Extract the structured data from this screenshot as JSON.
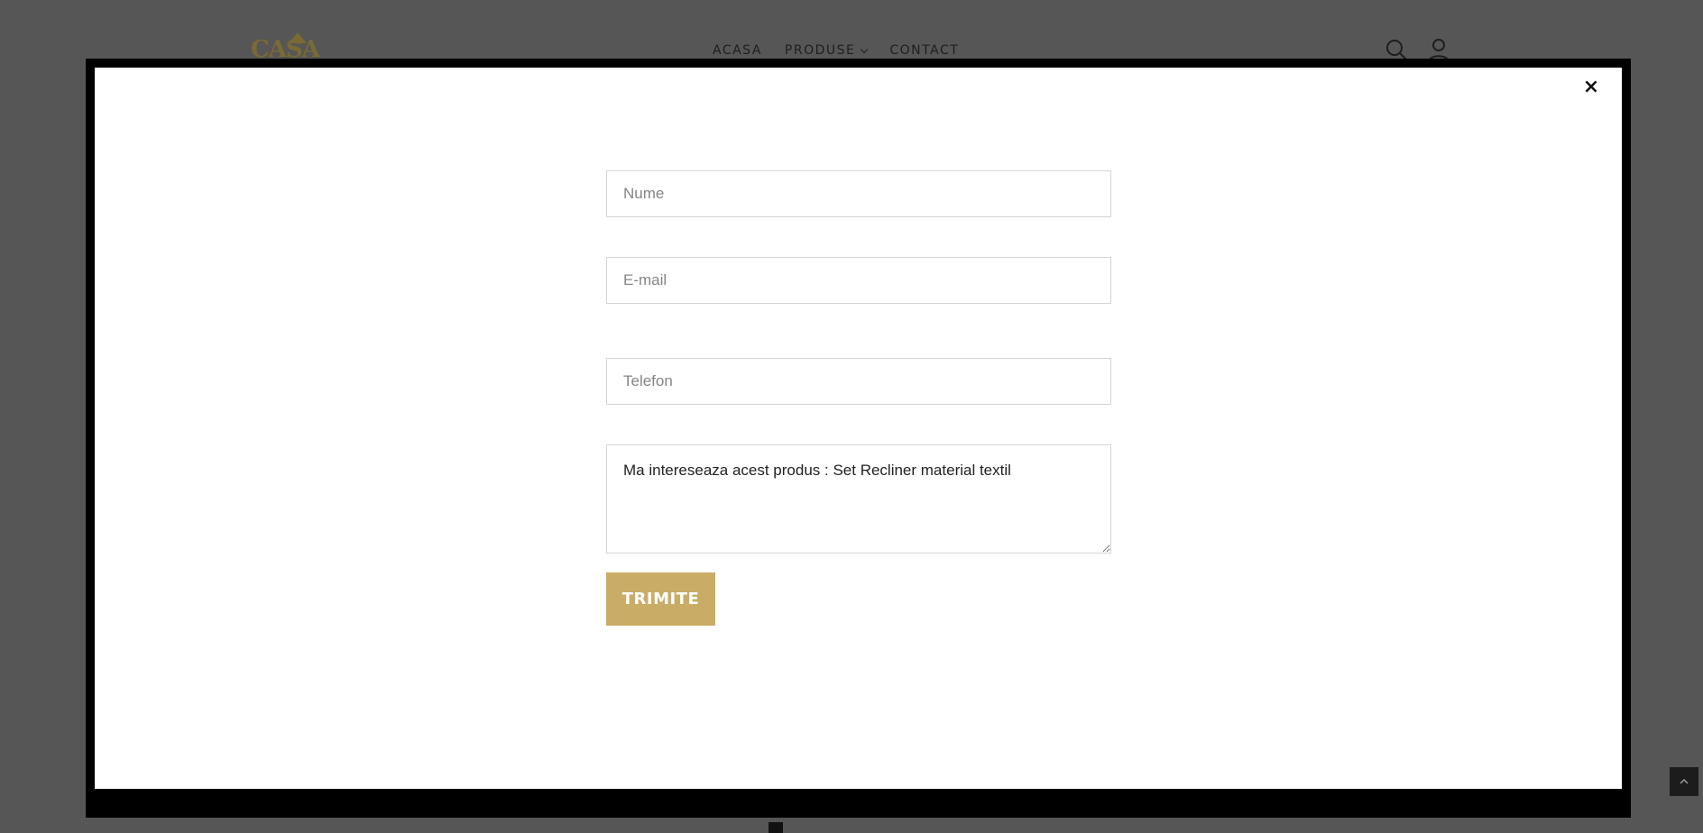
{
  "header": {
    "logo_text": "CASA",
    "nav": [
      {
        "label": "ACASA"
      },
      {
        "label": "PRODUSE"
      },
      {
        "label": "CONTACT"
      }
    ]
  },
  "modal": {
    "close_label": "×",
    "form": {
      "name_placeholder": "Nume",
      "email_placeholder": "E-mail",
      "phone_placeholder": "Telefon",
      "message_value": "Ma intereseaza acest produs : Set Recliner material textil",
      "submit_label": "TRIMITE"
    }
  },
  "colors": {
    "accent": "#c9ac66",
    "overlay": "#565656",
    "modal_border": "#000000"
  }
}
